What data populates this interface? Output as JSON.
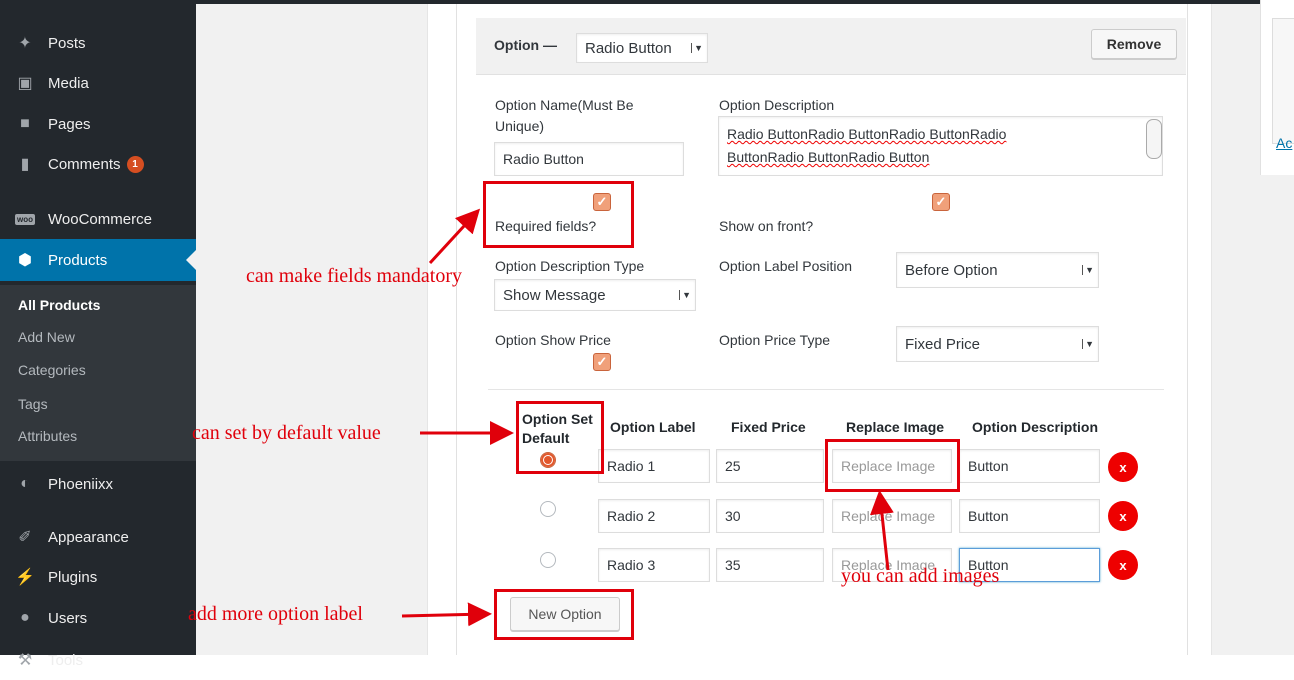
{
  "sidebar": {
    "items": [
      {
        "label": "Posts",
        "icon": "pin-icon"
      },
      {
        "label": "Media",
        "icon": "media-icon"
      },
      {
        "label": "Pages",
        "icon": "pages-icon"
      },
      {
        "label": "Comments",
        "icon": "comments-icon",
        "badge": "1"
      },
      {
        "label": "WooCommerce",
        "icon": "woocommerce-icon"
      },
      {
        "label": "Products",
        "icon": "products-icon"
      },
      {
        "label": "Phoeniixx",
        "icon": "phoeniixx-icon"
      },
      {
        "label": "Appearance",
        "icon": "appearance-icon"
      },
      {
        "label": "Plugins",
        "icon": "plugins-icon"
      },
      {
        "label": "Users",
        "icon": "users-icon"
      },
      {
        "label": "Tools",
        "icon": "tools-icon"
      }
    ],
    "submenu": [
      "All Products",
      "Add New",
      "Categories",
      "Tags",
      "Attributes"
    ]
  },
  "option_header": {
    "label": "Option —",
    "type_value": "Radio Button",
    "remove_label": "Remove"
  },
  "form": {
    "option_name_label": "Option Name(Must Be Unique)",
    "option_name_line1": "Option Name(Must Be",
    "option_name_line2": "Unique)",
    "option_name_value": "Radio Button",
    "option_description_label": "Option Description",
    "option_description_line1": "Radio ButtonRadio ButtonRadio ButtonRadio",
    "option_description_line2": "ButtonRadio ButtonRadio Button",
    "required_label": "Required fields?",
    "show_front_label": "Show on front?",
    "desc_type_label": "Option Description Type",
    "desc_type_value": "Show Message",
    "label_position_label": "Option Label Position",
    "label_position_value": "Before Option",
    "show_price_label": "Option Show Price",
    "price_type_label": "Option Price Type",
    "price_type_value": "Fixed Price"
  },
  "table": {
    "headers": {
      "default_line1": "Option Set",
      "default_line2": "Default",
      "label": "Option Label",
      "price": "Fixed Price",
      "image": "Replace Image",
      "description": "Option Description"
    },
    "rows": [
      {
        "label": "Radio 1",
        "price": "25",
        "image_placeholder": "Replace Image",
        "description": "Button",
        "default": true
      },
      {
        "label": "Radio 2",
        "price": "30",
        "image_placeholder": "Replace Image",
        "description": "Button",
        "default": false
      },
      {
        "label": "Radio 3",
        "price": "35",
        "image_placeholder": "Replace Image",
        "description": "Button",
        "default": false
      }
    ],
    "delete_label": "x",
    "new_option_label": "New Option"
  },
  "right_panel": {
    "link": "Ac"
  },
  "annotations": {
    "mandatory": "can make fields mandatory",
    "default": "can set by default value",
    "images": "you can add images",
    "more": "add more option label"
  },
  "colors": {
    "accent": "#0073aa",
    "annotation": "#e0000b",
    "checkbox": "#f0a07a",
    "sidebar": "#23282d"
  }
}
